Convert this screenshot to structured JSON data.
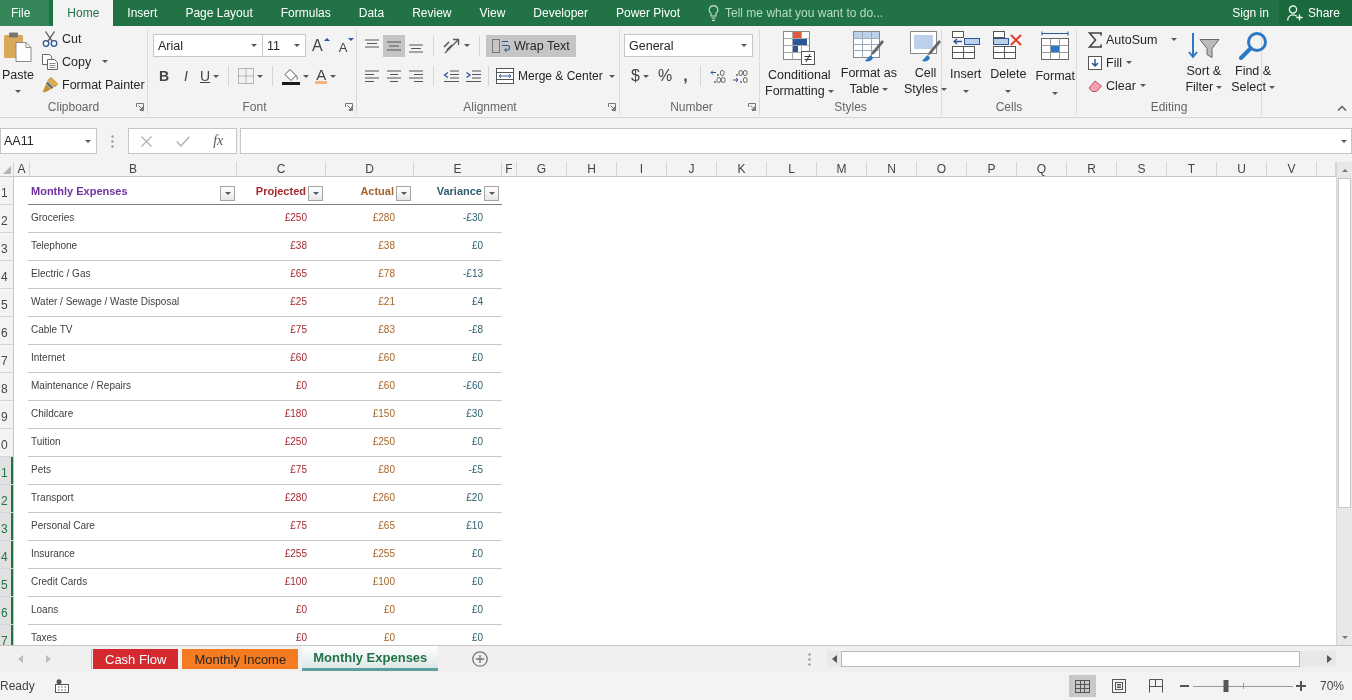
{
  "title_bar": {
    "tabs": [
      {
        "label": "File",
        "selected": false,
        "kind": "file"
      },
      {
        "label": "Home",
        "selected": true,
        "kind": "tab"
      },
      {
        "label": "Insert",
        "selected": false,
        "kind": "tab"
      },
      {
        "label": "Page Layout",
        "selected": false,
        "kind": "tab"
      },
      {
        "label": "Formulas",
        "selected": false,
        "kind": "tab"
      },
      {
        "label": "Data",
        "selected": false,
        "kind": "tab"
      },
      {
        "label": "Review",
        "selected": false,
        "kind": "tab"
      },
      {
        "label": "View",
        "selected": false,
        "kind": "tab"
      },
      {
        "label": "Developer",
        "selected": false,
        "kind": "tab"
      },
      {
        "label": "Power Pivot",
        "selected": false,
        "kind": "tab"
      }
    ],
    "tell_me": {
      "placeholder": "Tell me what you want to do..."
    },
    "sign_in": "Sign in",
    "share": "Share"
  },
  "ribbon": {
    "clipboard": {
      "label": "Clipboard",
      "paste": "Paste",
      "cut": "Cut",
      "copy": "Copy",
      "format_painter": "Format Painter"
    },
    "font": {
      "label": "Font",
      "font_name": "Arial",
      "font_size": "11",
      "grow": "A",
      "shrink": "A",
      "bold": "B",
      "italic": "I",
      "underline": "U",
      "font_color": "A"
    },
    "alignment": {
      "label": "Alignment",
      "vertical": [
        {
          "selected": false
        },
        {
          "selected": true
        },
        {
          "selected": false
        }
      ],
      "horizontal": [
        {
          "selected": false
        },
        {
          "selected": false
        },
        {
          "selected": false
        }
      ],
      "wrap_text": {
        "label": "Wrap Text",
        "on": true
      },
      "merge": "Merge & Center"
    },
    "number": {
      "label": "Number",
      "format": "General",
      "currency": "$",
      "percent": "%",
      "comma": ","
    },
    "styles": {
      "label": "Styles",
      "commands": [
        {
          "label": "Conditional\nFormatting",
          "kind": "conditional"
        },
        {
          "label": "Format as\nTable",
          "kind": "table"
        },
        {
          "label": "Cell\nStyles",
          "kind": "cell_styles"
        }
      ]
    },
    "cells": {
      "label": "Cells",
      "commands": [
        {
          "label": "Insert",
          "kind": "insert"
        },
        {
          "label": "Delete",
          "kind": "delete"
        },
        {
          "label": "Format",
          "kind": "format"
        }
      ]
    },
    "editing": {
      "label": "Editing",
      "autosum": "AutoSum",
      "fill": "Fill",
      "clear": "Clear",
      "sort_filter": "Sort &\nFilter",
      "find_select": "Find &\nSelect"
    }
  },
  "formula_bar": {
    "name_box": "AA11",
    "function_button": "fx"
  },
  "grid": {
    "columns": [
      "A",
      "B",
      "C",
      "D",
      "E",
      "F",
      "G",
      "H",
      "I",
      "J",
      "K",
      "L",
      "M",
      "N",
      "O",
      "P",
      "Q",
      "R",
      "S",
      "T",
      "U",
      "V"
    ],
    "row_headers": [
      {
        "label": "1",
        "selected": false
      },
      {
        "label": "2",
        "selected": false
      },
      {
        "label": "3",
        "selected": false
      },
      {
        "label": "4",
        "selected": false
      },
      {
        "label": "5",
        "selected": false
      },
      {
        "label": "6",
        "selected": false
      },
      {
        "label": "7",
        "selected": false
      },
      {
        "label": "8",
        "selected": false
      },
      {
        "label": "9",
        "selected": false
      },
      {
        "label": "0",
        "selected": false
      },
      {
        "label": "1",
        "selected": true
      },
      {
        "label": "2",
        "selected": true
      },
      {
        "label": "3",
        "selected": true
      },
      {
        "label": "4",
        "selected": true
      },
      {
        "label": "5",
        "selected": true
      },
      {
        "label": "6",
        "selected": true
      },
      {
        "label": "7",
        "selected": true
      }
    ],
    "table": {
      "columns": [
        {
          "label": "Monthly Expenses",
          "color": "#7030a0"
        },
        {
          "label": "Projected",
          "color": "#a52a2f"
        },
        {
          "label": "Actual",
          "color": "#a5642a"
        },
        {
          "label": "Variance",
          "color": "#2e5e6e"
        }
      ],
      "rows": [
        {
          "cells": [
            "Groceries",
            "£250",
            "£280",
            "-£30"
          ]
        },
        {
          "cells": [
            "Telephone",
            "£38",
            "£38",
            "£0"
          ]
        },
        {
          "cells": [
            "Electric / Gas",
            "£65",
            "£78",
            "-£13"
          ]
        },
        {
          "cells": [
            "Water / Sewage / Waste Disposal",
            "£25",
            "£21",
            "£4"
          ]
        },
        {
          "cells": [
            "Cable TV",
            "£75",
            "£83",
            "-£8"
          ]
        },
        {
          "cells": [
            "Internet",
            "£60",
            "£60",
            "£0"
          ]
        },
        {
          "cells": [
            "Maintenance / Repairs",
            "£0",
            "£60",
            "-£60"
          ]
        },
        {
          "cells": [
            "Childcare",
            "£180",
            "£150",
            "£30"
          ]
        },
        {
          "cells": [
            "Tuition",
            "£250",
            "£250",
            "£0"
          ]
        },
        {
          "cells": [
            "Pets",
            "£75",
            "£80",
            "-£5"
          ]
        },
        {
          "cells": [
            "Transport",
            "£280",
            "£260",
            "£20"
          ]
        },
        {
          "cells": [
            "Personal Care",
            "£75",
            "£65",
            "£10"
          ]
        },
        {
          "cells": [
            "Insurance",
            "£255",
            "£255",
            "£0"
          ]
        },
        {
          "cells": [
            "Credit Cards",
            "£100",
            "£100",
            "£0"
          ]
        },
        {
          "cells": [
            "Loans",
            "£0",
            "£0",
            "£0"
          ]
        },
        {
          "cells": [
            "Taxes",
            "£0",
            "£0",
            "£0"
          ]
        }
      ]
    }
  },
  "sheet_tabs": [
    {
      "label": "Cash Flow",
      "color": "#d3292f",
      "selected": false
    },
    {
      "label": "Monthly Income",
      "color": "#f47b20",
      "selected": false
    },
    {
      "label": "Monthly Expenses",
      "color": "#5f9ea0",
      "selected": true
    }
  ],
  "status_bar": {
    "mode": "Ready",
    "views": [
      {
        "kind": "normal",
        "selected": true
      },
      {
        "kind": "page_layout",
        "selected": false
      },
      {
        "kind": "page_break",
        "selected": false
      }
    ],
    "zoom": {
      "label": "70%",
      "level": 0.33
    }
  }
}
